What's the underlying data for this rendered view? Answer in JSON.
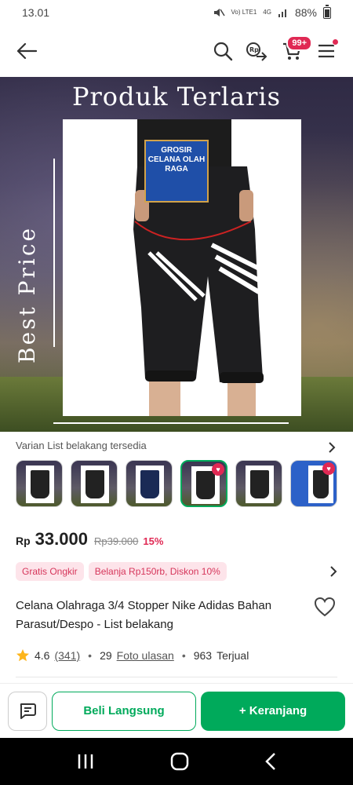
{
  "status": {
    "time": "13.01",
    "network": "Vo) LTE1",
    "signal_type": "4G",
    "battery": "88%"
  },
  "appbar": {
    "cart_badge": "99+",
    "icons": [
      "back-arrow-icon",
      "search-icon",
      "currency-share-icon",
      "cart-icon",
      "menu-icon"
    ]
  },
  "hero": {
    "title": "Produk Terlaris",
    "side_text": "Best Price",
    "logo_text": "GROSIR CELANA OLAH RAGA"
  },
  "variants": {
    "title": "Varian List belakang tersedia",
    "count": 7
  },
  "price": {
    "currency": "Rp",
    "value": "33.000",
    "original": "Rp39.000",
    "discount": "15%"
  },
  "promos": [
    "Gratis Ongkir",
    "Belanja Rp150rb, Diskon 10%"
  ],
  "product": {
    "title": "Celana Olahraga 3/4 Stopper Nike Adidas Bahan Parasut/Despo - List belakang"
  },
  "rating": {
    "score": "4.6",
    "reviews": "(341)",
    "photo_count": "29",
    "photo_label": "Foto ulasan",
    "sold_count": "963",
    "sold_label": "Terjual"
  },
  "actions": {
    "buy_now": "Beli Langsung",
    "add_cart": "+ Keranjang"
  },
  "colors": {
    "primary": "#00aa5b",
    "accent": "#e02954"
  }
}
